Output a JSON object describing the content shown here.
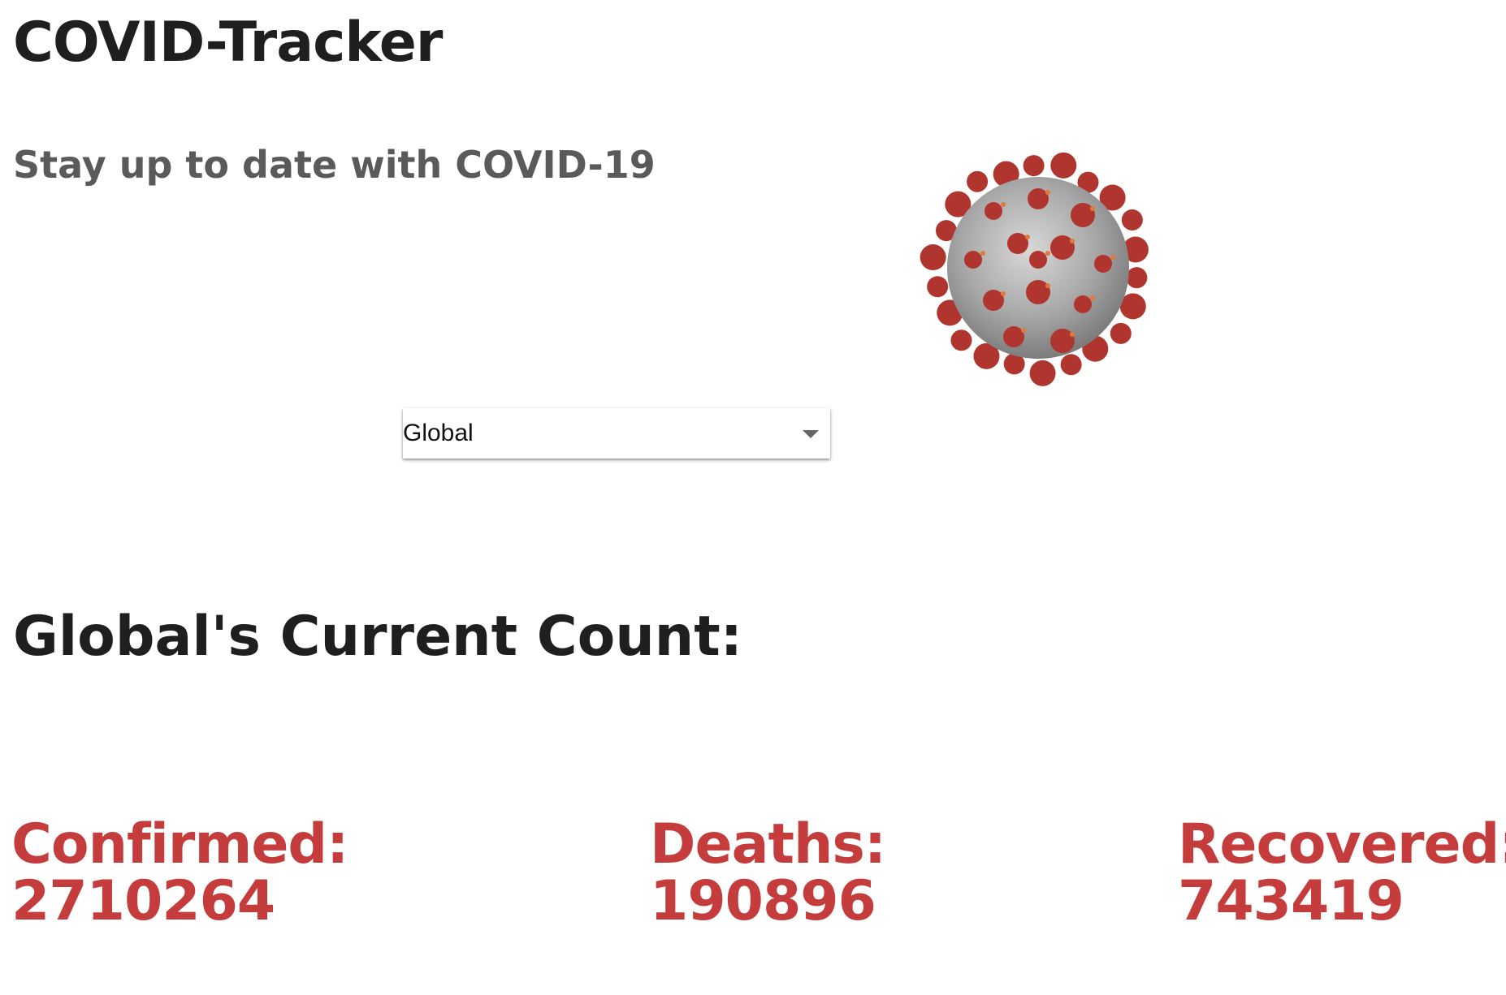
{
  "app": {
    "title": "COVID-Tracker",
    "subtitle": "Stay up to date with COVID-19"
  },
  "hero_image": {
    "icon": "coronavirus-icon",
    "colors": {
      "body": "#a9a9a9",
      "spike": "#b0352f",
      "accent": "#e07a3a"
    }
  },
  "region_select": {
    "selected": "Global"
  },
  "counts": {
    "heading": "Global's Current Count:",
    "accent_color": "#c43c3b",
    "stats": [
      {
        "label": "Confirmed:",
        "value": "2710264"
      },
      {
        "label": "Deaths:",
        "value": "190896"
      },
      {
        "label": "Recovered:",
        "value": "743419"
      }
    ]
  }
}
